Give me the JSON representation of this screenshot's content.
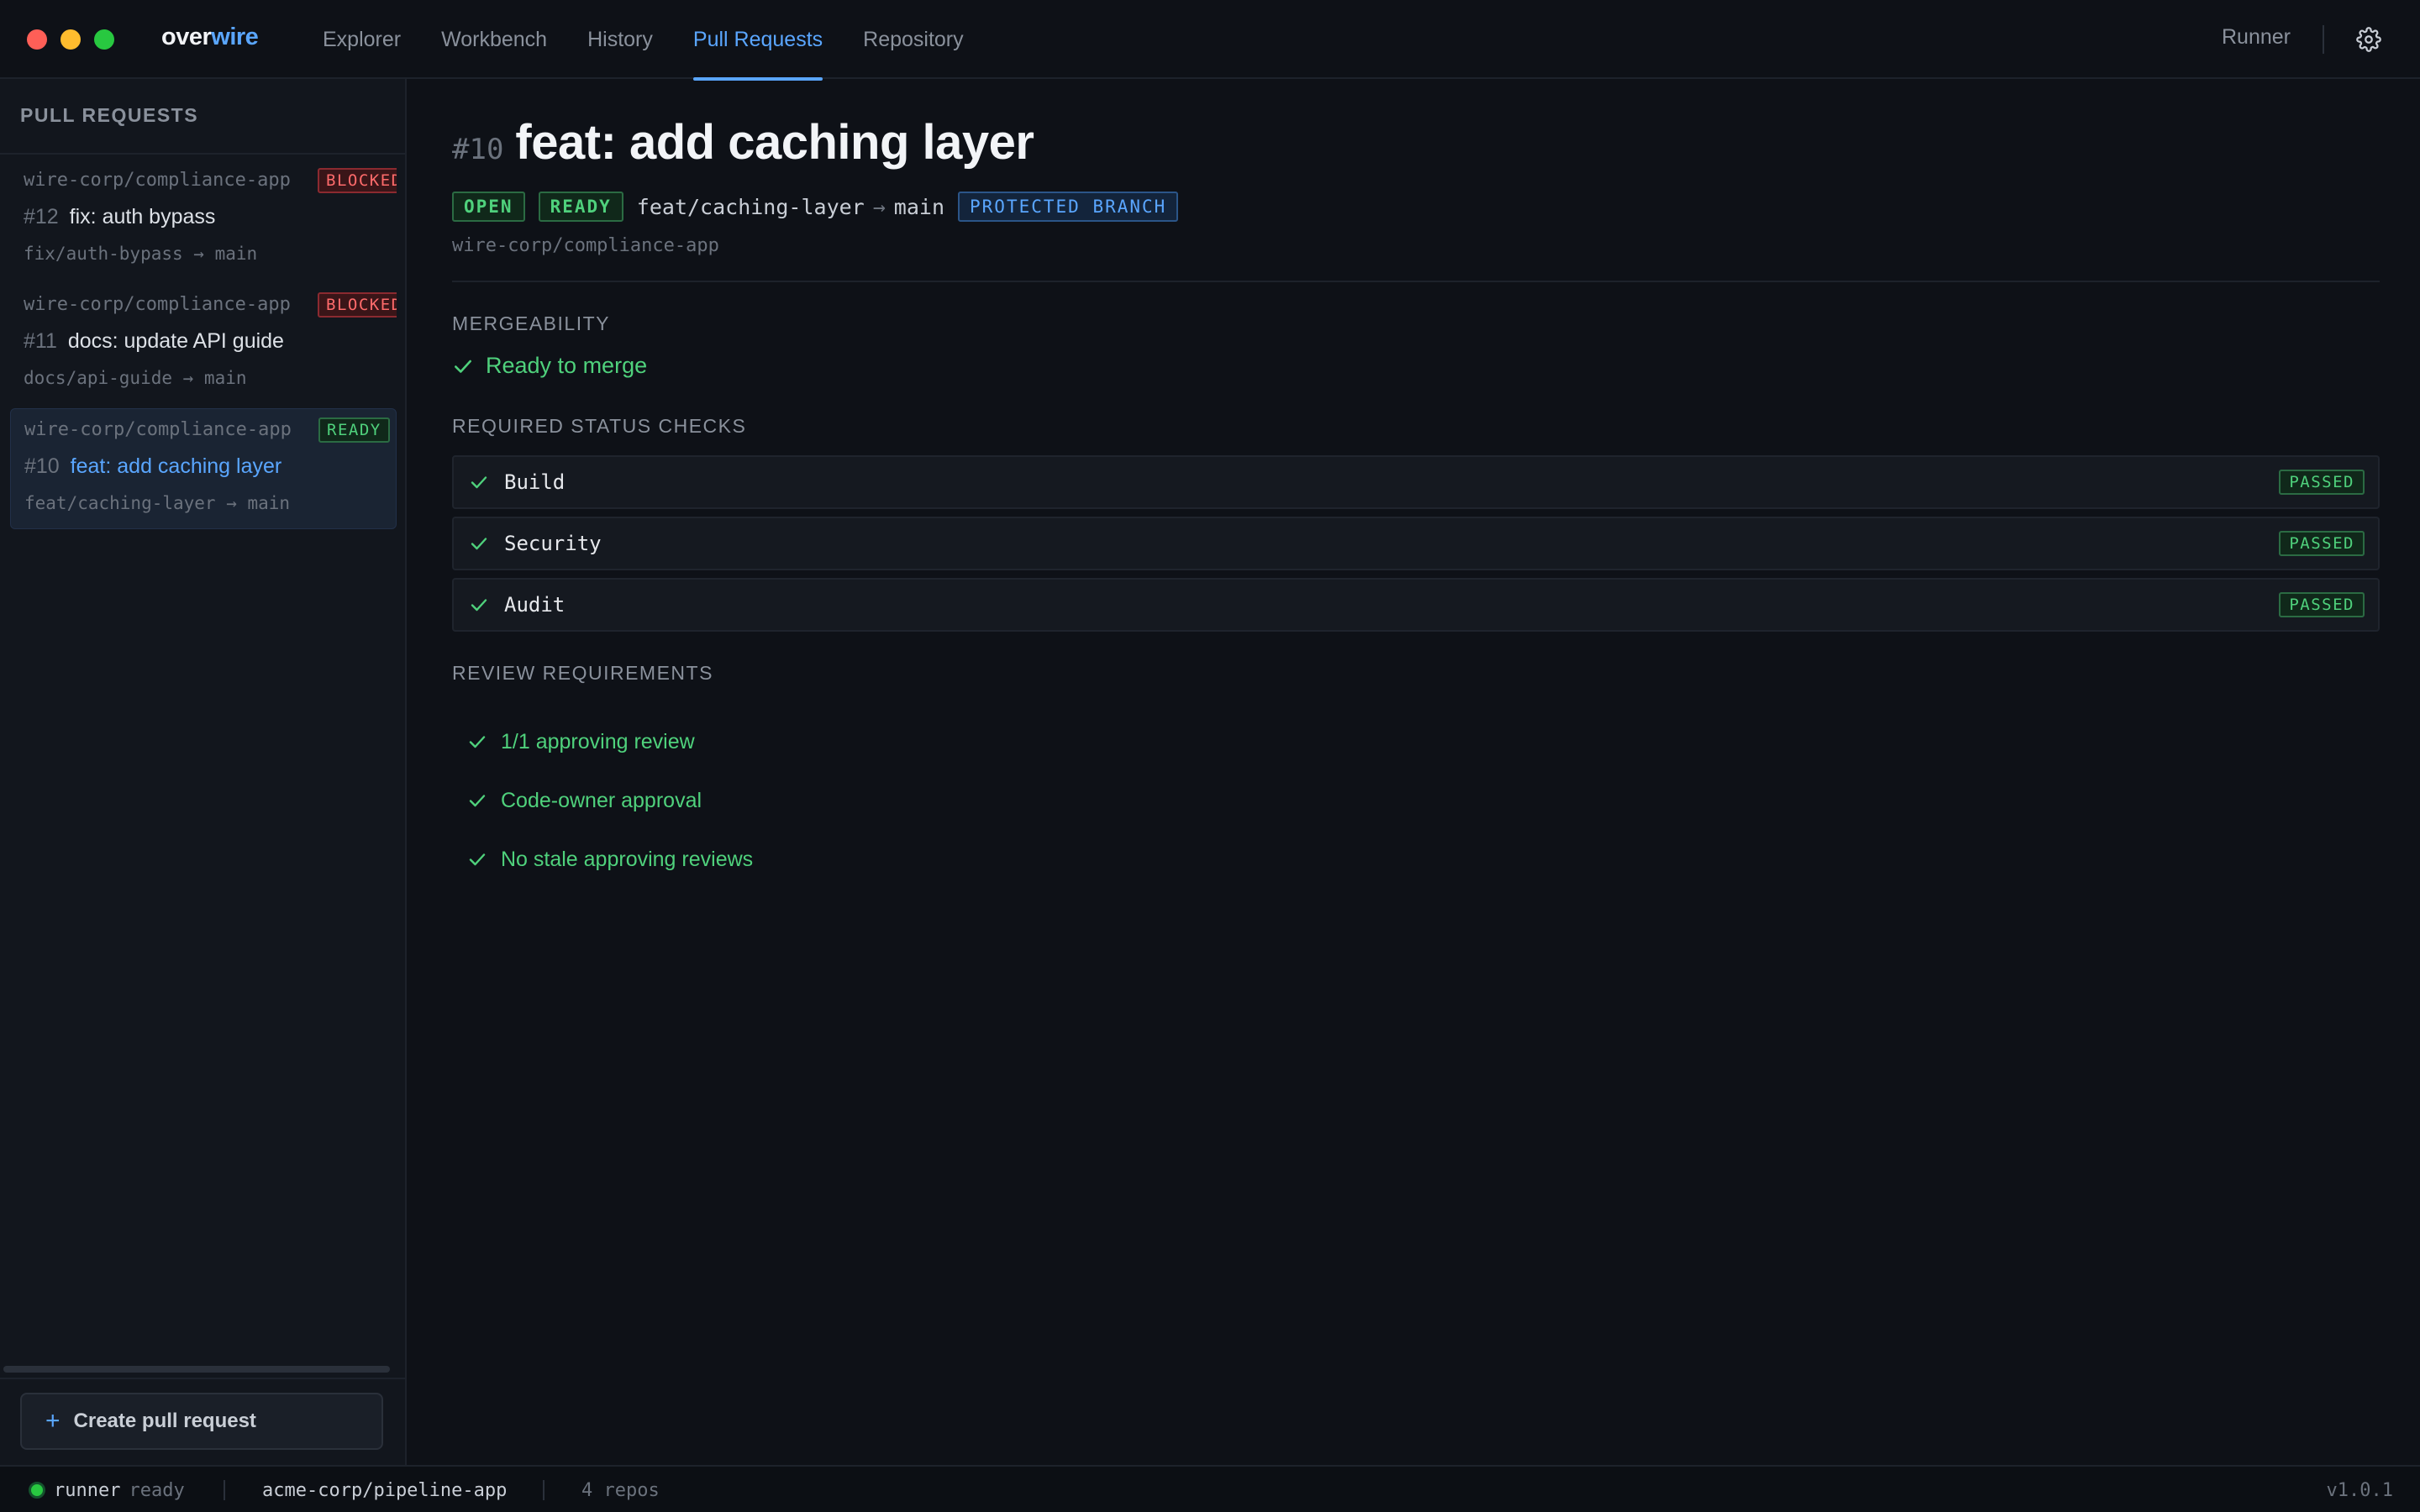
{
  "window": {
    "brand_part1": "over",
    "brand_part2": "wire"
  },
  "nav": {
    "items": [
      {
        "label": "Explorer"
      },
      {
        "label": "Workbench"
      },
      {
        "label": "History"
      },
      {
        "label": "Pull Requests",
        "active": true
      },
      {
        "label": "Repository"
      }
    ],
    "runner_label": "Runner",
    "settings_icon": "gear-icon"
  },
  "sidebar": {
    "title": "PULL REQUESTS",
    "items": [
      {
        "repo": "wire-corp/compliance-app",
        "badge": "BLOCKED",
        "number": "#12",
        "title": "fix: auth bypass",
        "branch": "fix/auth-bypass → main"
      },
      {
        "repo": "wire-corp/compliance-app",
        "badge": "BLOCKED",
        "number": "#11",
        "title": "docs: update API guide",
        "branch": "docs/api-guide → main"
      },
      {
        "repo": "wire-corp/compliance-app",
        "badge": "READY",
        "number": "#10",
        "title": "feat: add caching layer",
        "branch": "feat/caching-layer → main",
        "selected": true
      }
    ],
    "create_button": "Create pull request"
  },
  "pr": {
    "number": "#10",
    "title": "feat: add caching layer",
    "state_tag": "OPEN",
    "ready_tag": "READY",
    "source_branch": "feat/caching-layer",
    "arrow": "→",
    "target_branch": "main",
    "protected_tag": "PROTECTED BRANCH",
    "repo": "wire-corp/compliance-app"
  },
  "mergeability": {
    "label": "MERGEABILITY",
    "status": "Ready to merge"
  },
  "status_checks": {
    "label": "REQUIRED STATUS CHECKS",
    "items": [
      {
        "name": "Build",
        "result": "PASSED"
      },
      {
        "name": "Security",
        "result": "PASSED"
      },
      {
        "name": "Audit",
        "result": "PASSED"
      }
    ]
  },
  "review": {
    "label": "REVIEW REQUIREMENTS",
    "items": [
      {
        "text": "1/1 approving review"
      },
      {
        "text": "Code-owner approval"
      },
      {
        "text": "No stale approving reviews"
      }
    ]
  },
  "statusbar": {
    "runner": "runner",
    "runner_state": "ready",
    "repo": "acme-corp/pipeline-app",
    "repo_count": "4 repos",
    "version": "v1.0.1"
  },
  "colors": {
    "accent": "#5aa6ff",
    "success": "#4fd17c",
    "danger": "#ff6b6b",
    "background": "#0e1117"
  }
}
